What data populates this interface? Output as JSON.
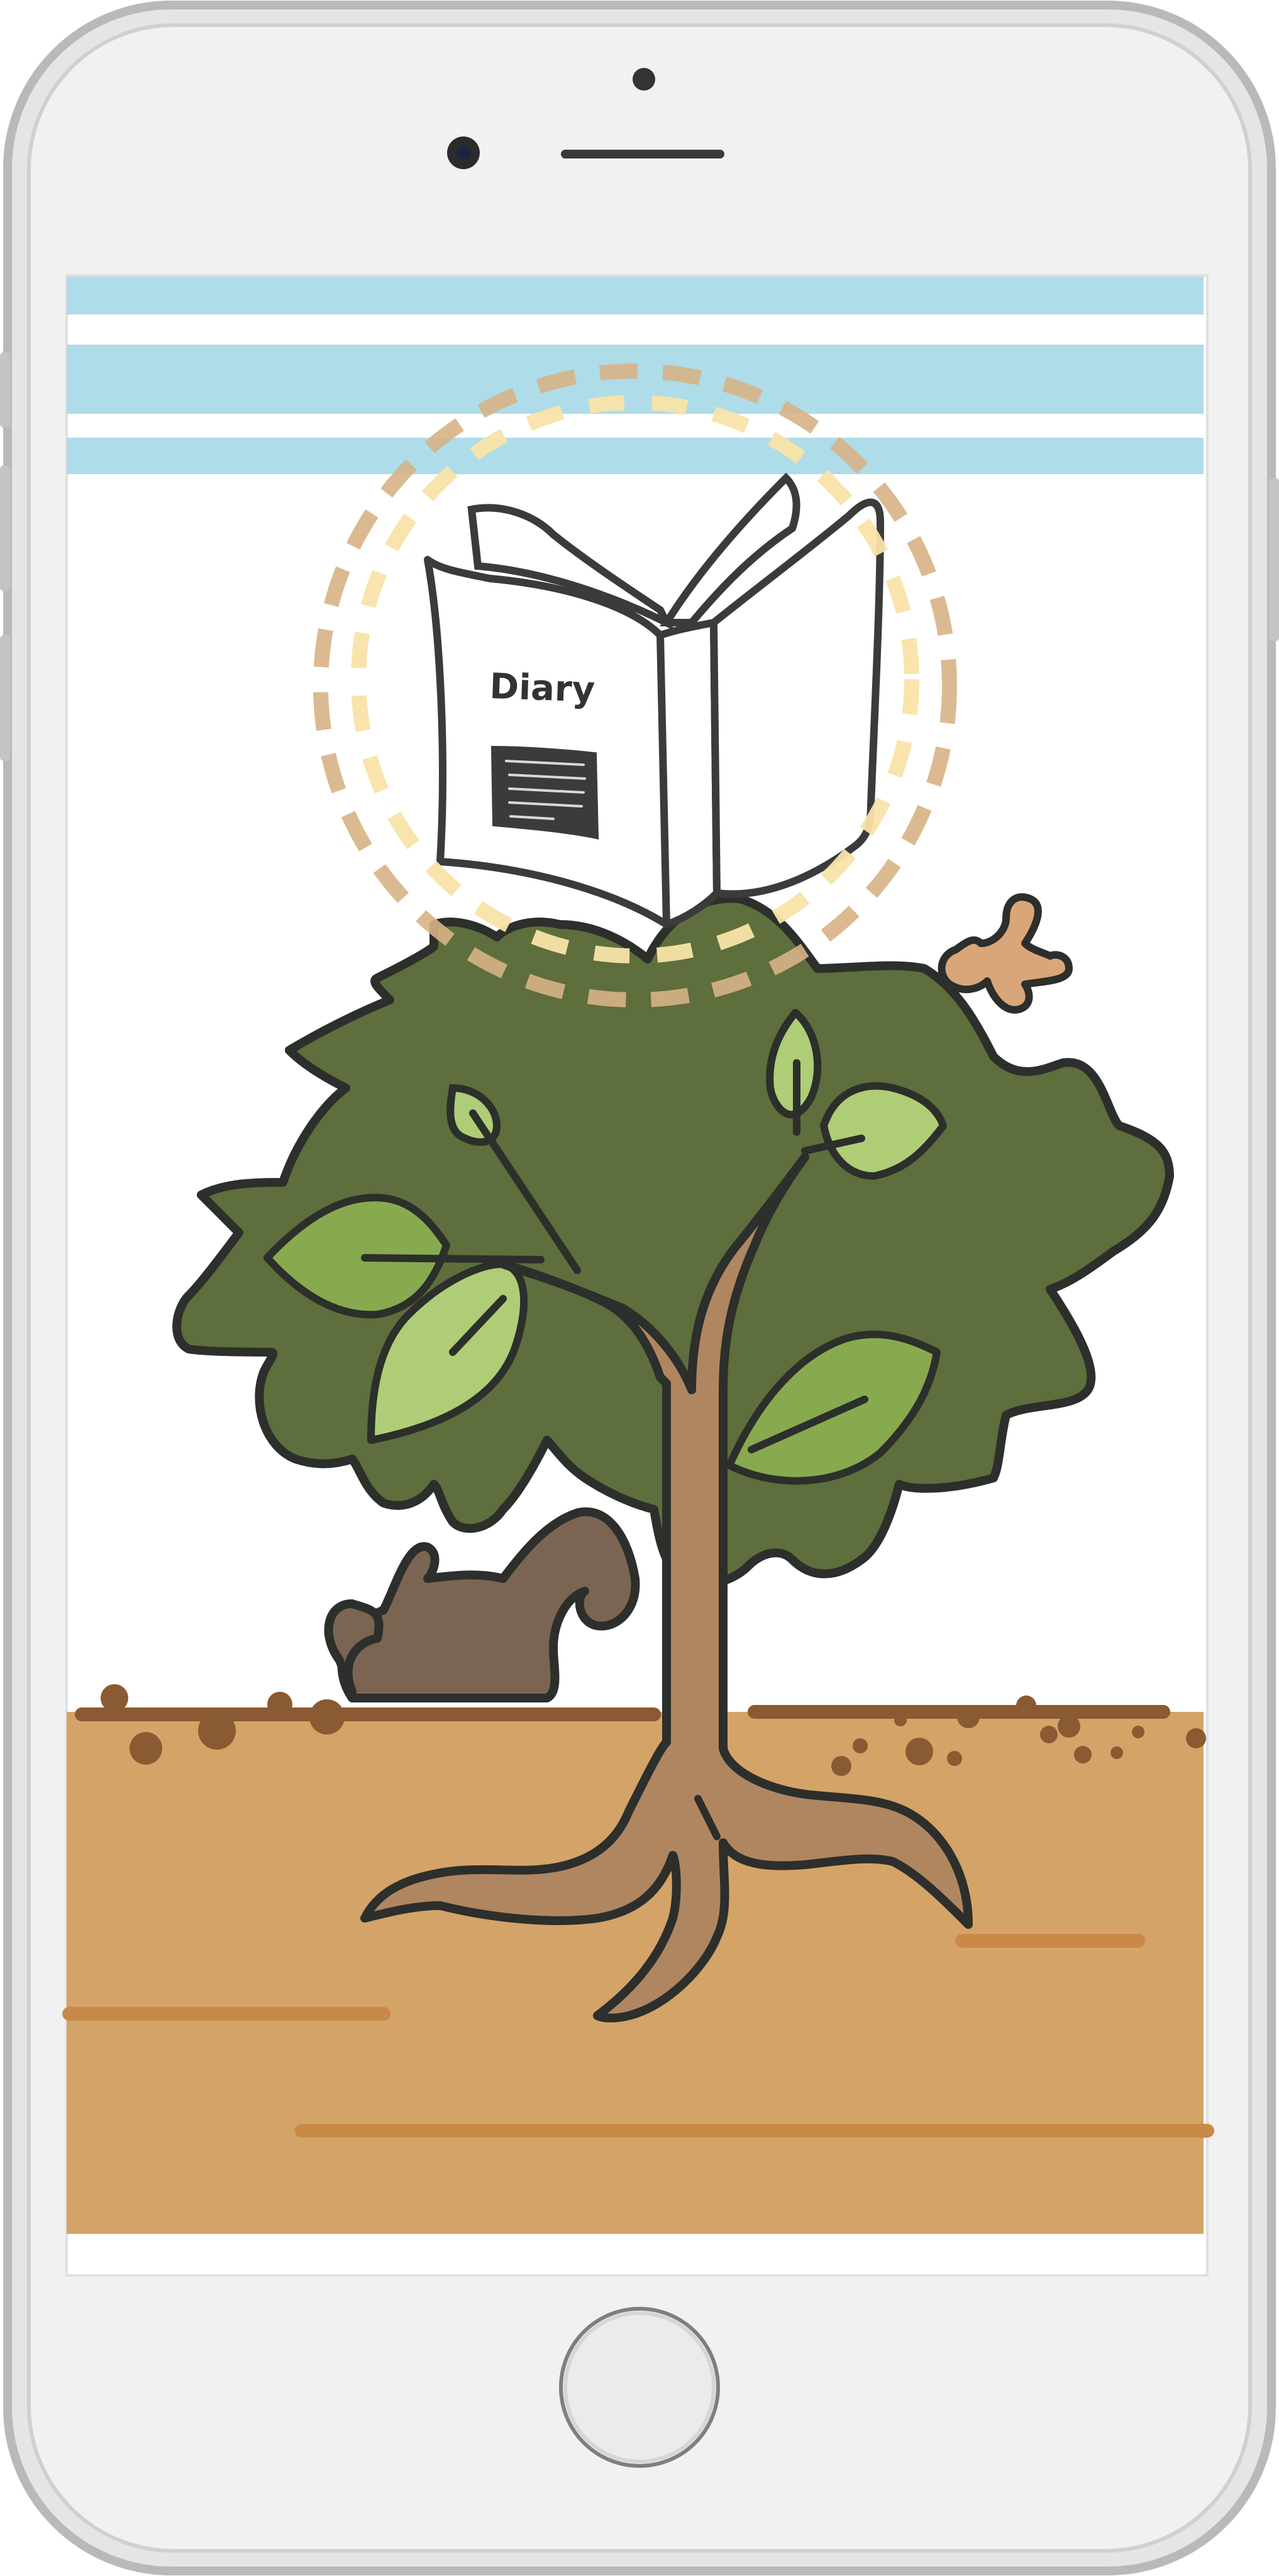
{
  "book": {
    "title": "Diary"
  },
  "colors": {
    "phone_frame": "#e8e8e8",
    "phone_frame_dark": "#bcbcbc",
    "screen_bg": "#ffffff",
    "sky_stripe": "#aedce8",
    "soil": "#d4a367",
    "soil_line": "#c98a48",
    "soil_top": "#8a5a33",
    "tree_canopy": "#5e6e3c",
    "leaf_light": "#aecd76",
    "leaf_mid": "#87aa4f",
    "trunk": "#b08660",
    "rock": "#7b6552",
    "halo_outer": "#d7b386",
    "halo_inner": "#f8e3a8",
    "outline": "#2c2f2b",
    "book_page": "#ffffff"
  },
  "icons": {
    "home_button": "home-button-icon",
    "front_camera": "camera-icon",
    "speaker": "speaker-icon",
    "book": "book-icon",
    "tree": "tree-icon"
  }
}
